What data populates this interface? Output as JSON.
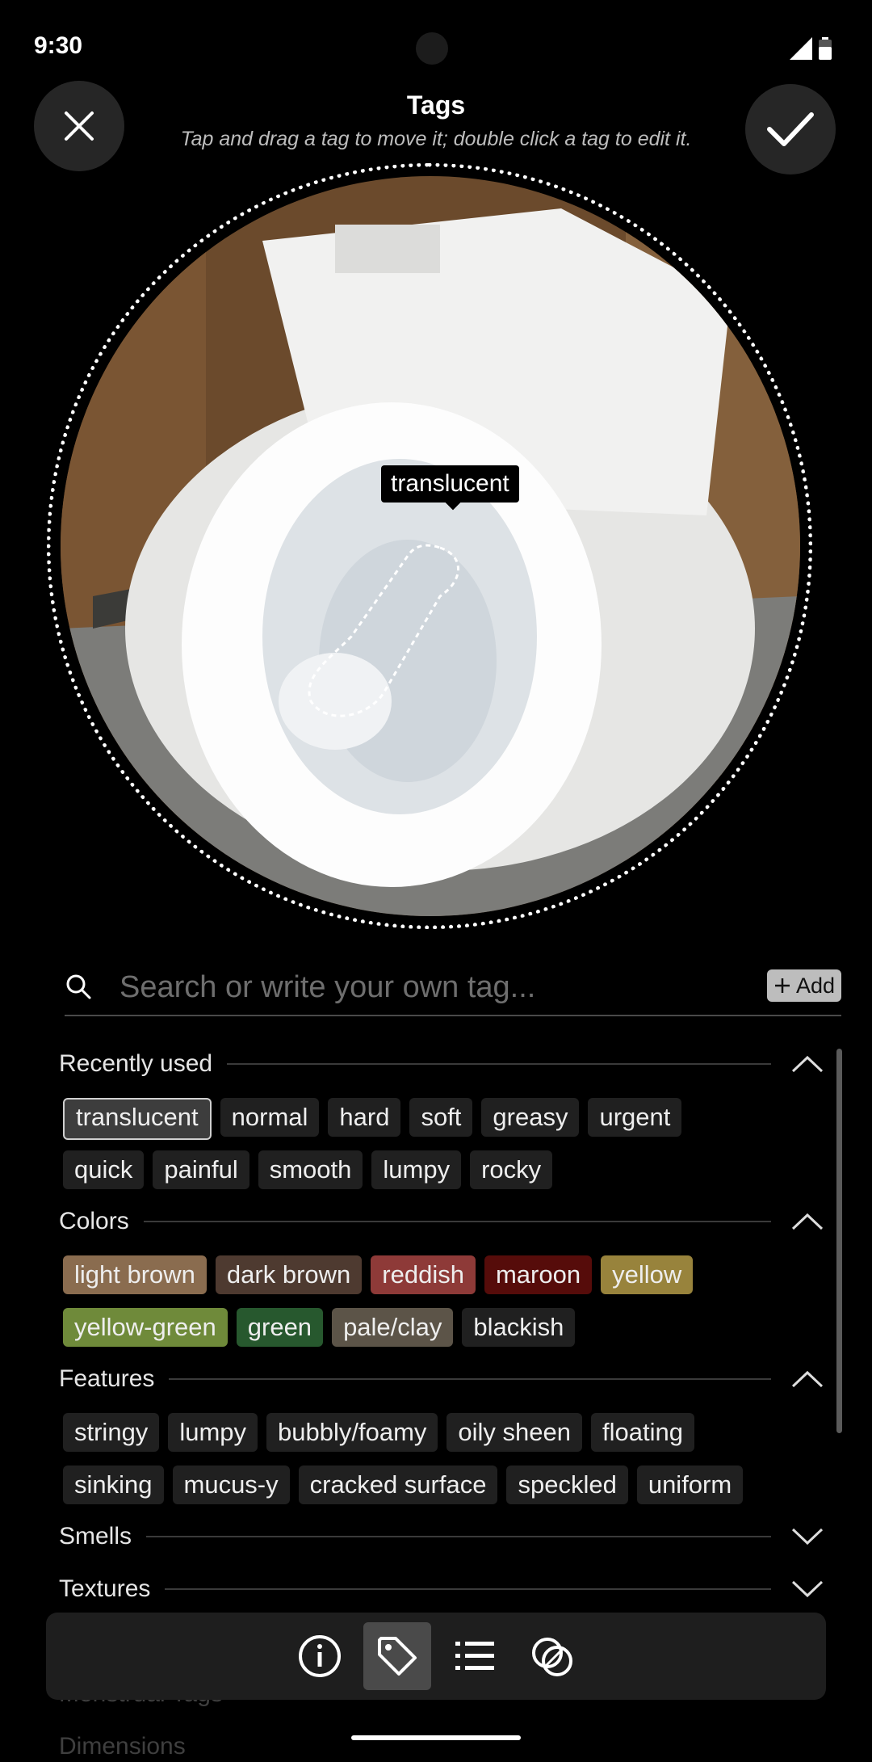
{
  "status": {
    "time": "9:30"
  },
  "header": {
    "title": "Tags",
    "subtitle": "Tap and drag a tag to move it; double click a tag to edit it."
  },
  "photo": {
    "placed_tag": "translucent"
  },
  "search": {
    "placeholder": "Search or write your own tag...",
    "value": "",
    "add_label": "Add"
  },
  "sections": {
    "recent": {
      "title": "Recently used",
      "row1": [
        "translucent",
        "normal",
        "hard",
        "soft",
        "greasy",
        "urgent"
      ],
      "row2": [
        "quick",
        "painful",
        "smooth",
        "lumpy",
        "rocky"
      ]
    },
    "colors": {
      "title": "Colors",
      "row1": [
        "light brown",
        "dark brown",
        "reddish",
        "maroon",
        "yellow"
      ],
      "row2": [
        "yellow-green",
        "green",
        "pale/clay",
        "blackish"
      ],
      "chip_colors": {
        "light brown": "#8a6c4f",
        "dark brown": "#4e3a30",
        "reddish": "#8e3a38",
        "maroon": "#560c0a",
        "yellow": "#98833c",
        "yellow-green": "#6f8a3a",
        "green": "#27582e",
        "pale/clay": "#5c5448",
        "blackish": "#202020"
      }
    },
    "features": {
      "title": "Features",
      "row1": [
        "stringy",
        "lumpy",
        "bubbly/foamy",
        "oily sheen",
        "floating"
      ],
      "row2": [
        "sinking",
        "mucus-y",
        "cracked surface",
        "speckled",
        "uniform"
      ]
    },
    "smells": {
      "title": "Smells"
    },
    "textures": {
      "title": "Textures"
    },
    "menstrual": {
      "title": "Menstrual Tags"
    },
    "dimensions": {
      "title": "Dimensions"
    }
  },
  "toolbar": {
    "items": [
      "info-icon",
      "tag-icon",
      "list-icon",
      "overlap-icon"
    ],
    "active": "tag-icon"
  }
}
